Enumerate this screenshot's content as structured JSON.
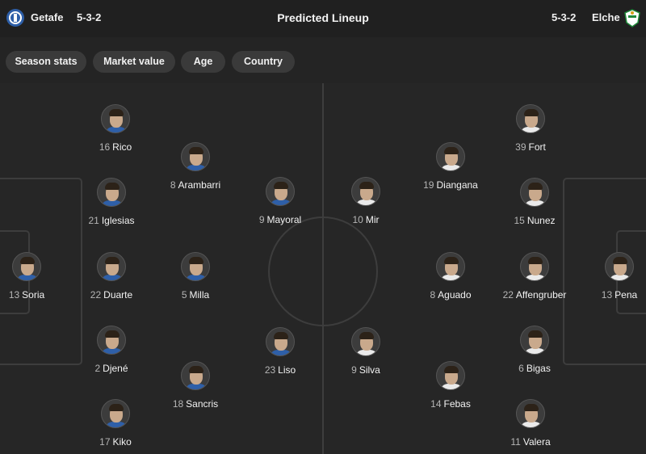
{
  "header": {
    "home_team": "Getafe",
    "home_formation": "5-3-2",
    "title": "Predicted Lineup",
    "away_formation": "5-3-2",
    "away_team": "Elche"
  },
  "tabs": [
    "Season stats",
    "Market value",
    "Age",
    "Country"
  ],
  "home_players": [
    {
      "number": "16",
      "name": "Rico"
    },
    {
      "number": "8",
      "name": "Arambarri"
    },
    {
      "number": "21",
      "name": "Iglesias"
    },
    {
      "number": "9",
      "name": "Mayoral"
    },
    {
      "number": "13",
      "name": "Soria"
    },
    {
      "number": "22",
      "name": "Duarte"
    },
    {
      "number": "5",
      "name": "Milla"
    },
    {
      "number": "2",
      "name": "Djené"
    },
    {
      "number": "23",
      "name": "Liso"
    },
    {
      "number": "18",
      "name": "Sancris"
    },
    {
      "number": "17",
      "name": "Kiko"
    }
  ],
  "away_players": [
    {
      "number": "39",
      "name": "Fort"
    },
    {
      "number": "19",
      "name": "Diangana"
    },
    {
      "number": "10",
      "name": "Mir"
    },
    {
      "number": "15",
      "name": "Nunez"
    },
    {
      "number": "8",
      "name": "Aguado"
    },
    {
      "number": "22",
      "name": "Affengruber"
    },
    {
      "number": "13",
      "name": "Pena"
    },
    {
      "number": "9",
      "name": "Silva"
    },
    {
      "number": "6",
      "name": "Bigas"
    },
    {
      "number": "14",
      "name": "Febas"
    },
    {
      "number": "11",
      "name": "Valera"
    }
  ],
  "colors": {
    "background": "#1d1d1d",
    "pitch": "#262626",
    "tab": "#3a3a3a",
    "getafe_blue": "#2e5fa8",
    "elche_green": "#1f8a3a"
  }
}
